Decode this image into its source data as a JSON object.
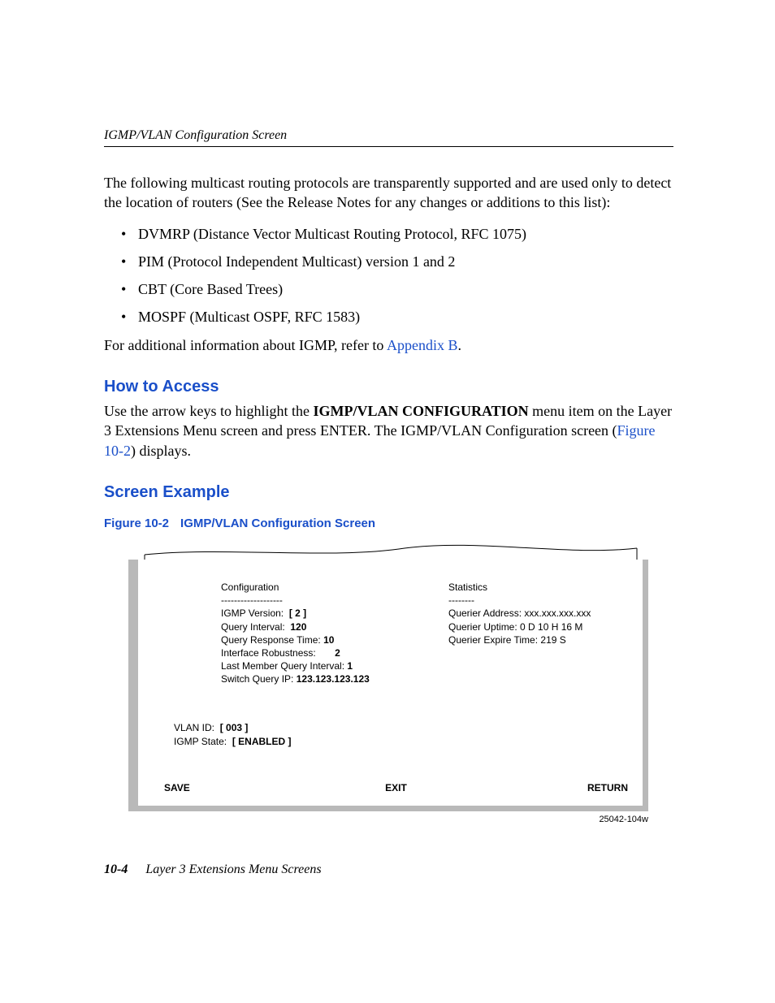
{
  "header": {
    "running_head": "IGMP/VLAN Configuration Screen"
  },
  "intro": {
    "para1": "The following multicast routing protocols are transparently supported and are used only to detect the location of routers (See the Release Notes for any changes or additions to this list):",
    "bullets": [
      "DVMRP (Distance Vector Multicast Routing Protocol, RFC 1075)",
      "PIM (Protocol Independent Multicast) version 1 and 2",
      "CBT (Core Based Trees)",
      "MOSPF (Multicast OSPF, RFC 1583)"
    ],
    "para2_prefix": "For additional information about IGMP, refer to ",
    "para2_link": "Appendix B",
    "para2_suffix": "."
  },
  "how_to_access": {
    "heading": "How to Access",
    "text_prefix": "Use the arrow keys to highlight the ",
    "bold_item": "IGMP/VLAN CONFIGURATION",
    "text_mid": " menu item on the Layer 3 Extensions Menu screen and press ENTER. The IGMP/VLAN Configuration screen (",
    "link": "Figure 10-2",
    "text_suffix": ") displays."
  },
  "screen_example": {
    "heading": "Screen Example",
    "caption_num": "Figure 10-2",
    "caption_title": "IGMP/VLAN Configuration Screen"
  },
  "terminal": {
    "config": {
      "title": "Configuration",
      "rule": "-------------------",
      "igmp_version_lbl": "IGMP Version:",
      "igmp_version_val": "[  2 ]",
      "query_interval_lbl": "Query Interval:",
      "query_interval_val": "120",
      "query_response_lbl": "Query Response Time:",
      "query_response_val": "10",
      "iface_robust_lbl": "Interface Robustness:",
      "iface_robust_val": "2",
      "last_member_lbl": "Last Member Query Interval:",
      "last_member_val": "1",
      "switch_ip_lbl": "Switch Query IP:",
      "switch_ip_val": "123.123.123.123"
    },
    "stats": {
      "title": "Statistics",
      "rule": "--------",
      "qaddr_lbl": "Querier Address:",
      "qaddr_val": "xxx.xxx.xxx.xxx",
      "quptime_lbl": "Querier Uptime:",
      "quptime_val": "0 D 10 H 16 M",
      "qexp_lbl": "Querier Expire Time:",
      "qexp_val": "219 S"
    },
    "state": {
      "vlan_lbl": "VLAN ID:",
      "vlan_val": "[ 003 ]",
      "igmp_state_lbl": "IGMP State:",
      "igmp_state_val": "[ ENABLED ]"
    },
    "buttons": {
      "save": "SAVE",
      "exit": "EXIT",
      "ret": "RETURN"
    },
    "figure_number": "25042-104w"
  },
  "footer": {
    "page": "10-4",
    "title": "Layer 3 Extensions Menu Screens"
  }
}
